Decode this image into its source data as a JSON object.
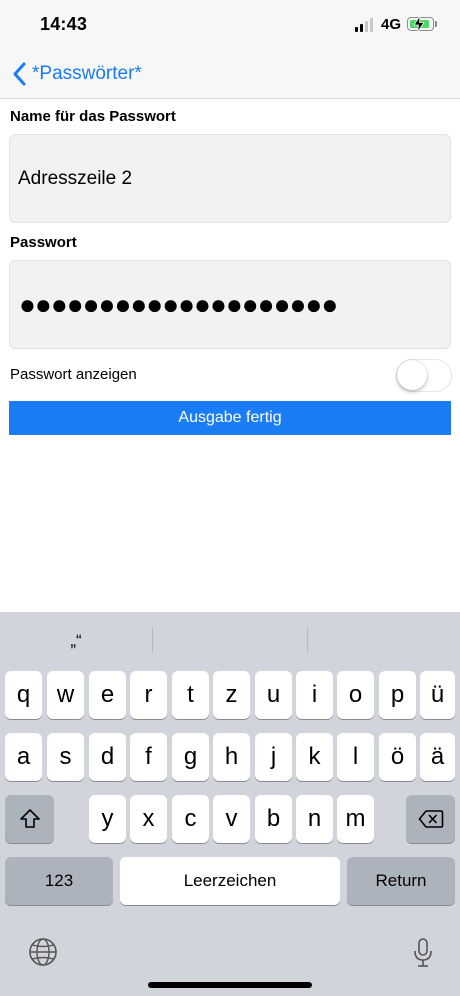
{
  "status_bar": {
    "time": "14:43",
    "network": "4G",
    "signal_bars_active": 2,
    "signal_bars_total": 4,
    "battery_icon": "battery-charging-icon",
    "battery_color": "#4cd964"
  },
  "nav": {
    "back_label": "*Passwörter*",
    "back_icon": "chevron-left-icon",
    "accent": "#1a7cf3"
  },
  "form": {
    "name_label": "Name für das Passwort",
    "name_value": "Adresszeile 2",
    "password_label": "Passwort",
    "password_masked": "●●●●●●●●●●●●●●●●●●●●",
    "show_password_label": "Passwort anzeigen",
    "show_password_on": false,
    "done_label": "Ausgabe fertig",
    "done_color": "#1b7df6"
  },
  "keyboard": {
    "suggestions": [
      "„“",
      "",
      ""
    ],
    "row1": [
      "q",
      "w",
      "e",
      "r",
      "t",
      "z",
      "u",
      "i",
      "o",
      "p",
      "ü"
    ],
    "row2": [
      "a",
      "s",
      "d",
      "f",
      "g",
      "h",
      "j",
      "k",
      "l",
      "ö",
      "ä"
    ],
    "row3": [
      "y",
      "x",
      "c",
      "v",
      "b",
      "n",
      "m"
    ],
    "shift_icon": "shift-icon",
    "delete_icon": "backspace-icon",
    "numbers_label": "123",
    "space_label": "Leerzeichen",
    "return_label": "Return",
    "globe_icon": "globe-icon",
    "mic_icon": "microphone-icon"
  }
}
